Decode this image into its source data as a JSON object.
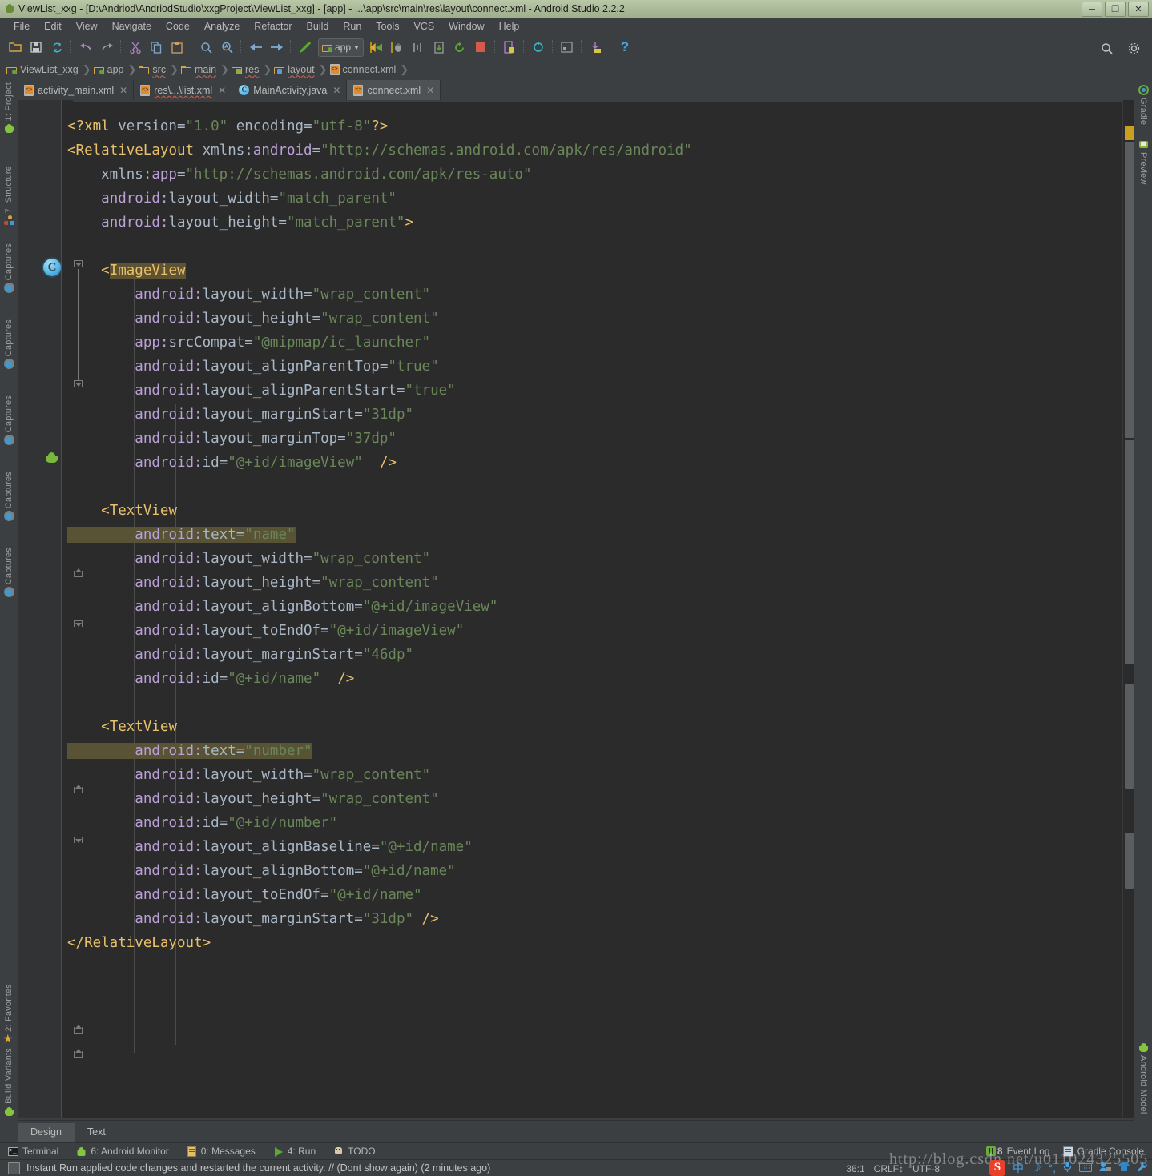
{
  "window": {
    "title": "ViewList_xxg - [D:\\Andriod\\AndriodStudio\\xxgProject\\ViewList_xxg] - [app] - ...\\app\\src\\main\\res\\layout\\connect.xml - Android Studio 2.2.2",
    "minimize": "─",
    "maximize": "❐",
    "close": "✕"
  },
  "menubar": [
    {
      "label": "File"
    },
    {
      "label": "Edit"
    },
    {
      "label": "View"
    },
    {
      "label": "Navigate"
    },
    {
      "label": "Code"
    },
    {
      "label": "Analyze"
    },
    {
      "label": "Refactor"
    },
    {
      "label": "Build"
    },
    {
      "label": "Run"
    },
    {
      "label": "Tools"
    },
    {
      "label": "VCS"
    },
    {
      "label": "Window"
    },
    {
      "label": "Help"
    }
  ],
  "toolbar": {
    "run_config": "app",
    "run_config_arrow": "▼",
    "icons": [
      "open-project-icon",
      "save-all-icon",
      "sync-icon",
      "undo-icon",
      "redo-icon",
      "cut-icon",
      "copy-icon",
      "paste-icon",
      "find-icon",
      "replace-icon",
      "back-icon",
      "forward-icon",
      "build-icon"
    ],
    "right_icons": [
      "search-everywhere-icon",
      "help-icon"
    ],
    "help_glyph": "?",
    "search_glyph": "⌕"
  },
  "breadcrumb": [
    {
      "label": "ViewList_xxg",
      "icon": "module-folder-icon"
    },
    {
      "label": "app",
      "icon": "module-folder-icon"
    },
    {
      "label": "src",
      "icon": "folder-icon"
    },
    {
      "label": "main",
      "icon": "folder-icon"
    },
    {
      "label": "res",
      "icon": "res-folder-icon"
    },
    {
      "label": "layout",
      "icon": "layout-folder-icon"
    },
    {
      "label": "connect.xml",
      "icon": "xml-file-icon"
    }
  ],
  "breadcrumb_separator": "❯",
  "editor_tabs": [
    {
      "label": "activity_main.xml",
      "icon": "xml-file-icon",
      "active": false,
      "squiggly": false
    },
    {
      "label": "res\\...\\list.xml",
      "icon": "xml-file-icon",
      "active": false,
      "squiggly": true
    },
    {
      "label": "MainActivity.java",
      "icon": "java-class-icon",
      "active": false,
      "squiggly": false
    },
    {
      "label": "connect.xml",
      "icon": "xml-file-icon",
      "active": true,
      "squiggly": false
    }
  ],
  "tab_close_glyph": "✕",
  "left_tool_strip": [
    {
      "label": "1: Project",
      "icon": "android-icon"
    },
    {
      "label": "7: Structure",
      "icon": "structure-icon"
    },
    {
      "label": "Captures",
      "icon": "captures-icon"
    },
    {
      "label": "Captures",
      "icon": "captures-icon"
    },
    {
      "label": "Captures",
      "icon": "captures-icon"
    },
    {
      "label": "Captures",
      "icon": "captures-icon"
    },
    {
      "label": "Captures",
      "icon": "captures-icon"
    },
    {
      "label": "2: Favorites",
      "icon": "star-icon"
    },
    {
      "label": "Build Variants",
      "icon": "android-icon"
    }
  ],
  "right_tool_strip": [
    {
      "label": "Gradle",
      "icon": "gradle-icon"
    },
    {
      "label": "Preview",
      "icon": "preview-icon"
    },
    {
      "label": "Android Model",
      "icon": "android-icon"
    }
  ],
  "code": {
    "language": "xml",
    "lines": [
      [
        {
          "t": "<?xml ",
          "c": "tag"
        },
        {
          "t": "version=",
          "c": "plain"
        },
        {
          "t": "\"1.0\"",
          "c": "val"
        },
        {
          "t": " encoding=",
          "c": "plain"
        },
        {
          "t": "\"utf-8\"",
          "c": "val"
        },
        {
          "t": "?>",
          "c": "tag"
        }
      ],
      [
        {
          "t": "<",
          "c": "brack"
        },
        {
          "t": "RelativeLayout",
          "c": "tag"
        },
        {
          "t": " xmlns:",
          "c": "plain"
        },
        {
          "t": "android",
          "c": "attr"
        },
        {
          "t": "=",
          "c": "plain"
        },
        {
          "t": "\"http://schemas.android.com/apk/res/android\"",
          "c": "val"
        }
      ],
      [
        {
          "t": "    xmlns:",
          "c": "plain"
        },
        {
          "t": "app",
          "c": "attr"
        },
        {
          "t": "=",
          "c": "plain"
        },
        {
          "t": "\"http://schemas.android.com/apk/res-auto\"",
          "c": "val"
        }
      ],
      [
        {
          "t": "    ",
          "c": "plain"
        },
        {
          "t": "android:",
          "c": "attr"
        },
        {
          "t": "layout_width",
          "c": "plain"
        },
        {
          "t": "=",
          "c": "plain"
        },
        {
          "t": "\"match_parent\"",
          "c": "val"
        }
      ],
      [
        {
          "t": "    ",
          "c": "plain"
        },
        {
          "t": "android:",
          "c": "attr"
        },
        {
          "t": "layout_height",
          "c": "plain"
        },
        {
          "t": "=",
          "c": "plain"
        },
        {
          "t": "\"match_parent\"",
          "c": "val"
        },
        {
          "t": ">",
          "c": "brack"
        }
      ],
      [],
      [
        {
          "t": "    ",
          "c": "plain"
        },
        {
          "t": "<",
          "c": "brack"
        },
        {
          "t": "ImageView",
          "c": "tag",
          "hl": "tag"
        }
      ],
      [
        {
          "t": "        ",
          "c": "plain"
        },
        {
          "t": "android:",
          "c": "attr"
        },
        {
          "t": "layout_width",
          "c": "plain"
        },
        {
          "t": "=",
          "c": "plain"
        },
        {
          "t": "\"wrap_content\"",
          "c": "val"
        }
      ],
      [
        {
          "t": "        ",
          "c": "plain"
        },
        {
          "t": "android:",
          "c": "attr"
        },
        {
          "t": "layout_height",
          "c": "plain"
        },
        {
          "t": "=",
          "c": "plain"
        },
        {
          "t": "\"wrap_content\"",
          "c": "val"
        }
      ],
      [
        {
          "t": "        ",
          "c": "plain"
        },
        {
          "t": "app:",
          "c": "attr"
        },
        {
          "t": "srcCompat",
          "c": "plain"
        },
        {
          "t": "=",
          "c": "plain"
        },
        {
          "t": "\"@mipmap/ic_launcher\"",
          "c": "val"
        }
      ],
      [
        {
          "t": "        ",
          "c": "plain"
        },
        {
          "t": "android:",
          "c": "attr"
        },
        {
          "t": "layout_alignParentTop",
          "c": "plain"
        },
        {
          "t": "=",
          "c": "plain"
        },
        {
          "t": "\"true\"",
          "c": "val"
        }
      ],
      [
        {
          "t": "        ",
          "c": "plain"
        },
        {
          "t": "android:",
          "c": "attr"
        },
        {
          "t": "layout_alignParentStart",
          "c": "plain"
        },
        {
          "t": "=",
          "c": "plain"
        },
        {
          "t": "\"true\"",
          "c": "val"
        }
      ],
      [
        {
          "t": "        ",
          "c": "plain"
        },
        {
          "t": "android:",
          "c": "attr"
        },
        {
          "t": "layout_marginStart",
          "c": "plain"
        },
        {
          "t": "=",
          "c": "plain"
        },
        {
          "t": "\"31dp\"",
          "c": "val"
        }
      ],
      [
        {
          "t": "        ",
          "c": "plain"
        },
        {
          "t": "android:",
          "c": "attr"
        },
        {
          "t": "layout_marginTop",
          "c": "plain"
        },
        {
          "t": "=",
          "c": "plain"
        },
        {
          "t": "\"37dp\"",
          "c": "val"
        }
      ],
      [
        {
          "t": "        ",
          "c": "plain"
        },
        {
          "t": "android:",
          "c": "attr"
        },
        {
          "t": "id",
          "c": "plain"
        },
        {
          "t": "=",
          "c": "plain"
        },
        {
          "t": "\"@+id/imageView\"",
          "c": "val"
        },
        {
          "t": "  ",
          "c": "plain"
        },
        {
          "t": "/>",
          "c": "brack"
        }
      ],
      [],
      [
        {
          "t": "    ",
          "c": "plain"
        },
        {
          "t": "<",
          "c": "brack"
        },
        {
          "t": "TextView",
          "c": "tag"
        }
      ],
      [
        {
          "t": "        ",
          "c": "plain",
          "hl": "line"
        },
        {
          "t": "android:",
          "c": "attr",
          "hl": "line"
        },
        {
          "t": "text",
          "c": "plain",
          "hl": "line"
        },
        {
          "t": "=",
          "c": "plain",
          "hl": "line"
        },
        {
          "t": "\"name\"",
          "c": "val",
          "hl": "line"
        }
      ],
      [
        {
          "t": "        ",
          "c": "plain"
        },
        {
          "t": "android:",
          "c": "attr"
        },
        {
          "t": "layout_width",
          "c": "plain"
        },
        {
          "t": "=",
          "c": "plain"
        },
        {
          "t": "\"wrap_content\"",
          "c": "val"
        }
      ],
      [
        {
          "t": "        ",
          "c": "plain"
        },
        {
          "t": "android:",
          "c": "attr"
        },
        {
          "t": "layout_height",
          "c": "plain"
        },
        {
          "t": "=",
          "c": "plain"
        },
        {
          "t": "\"wrap_content\"",
          "c": "val"
        }
      ],
      [
        {
          "t": "        ",
          "c": "plain"
        },
        {
          "t": "android:",
          "c": "attr"
        },
        {
          "t": "layout_alignBottom",
          "c": "plain"
        },
        {
          "t": "=",
          "c": "plain"
        },
        {
          "t": "\"@+id/imageView\"",
          "c": "val"
        }
      ],
      [
        {
          "t": "        ",
          "c": "plain"
        },
        {
          "t": "android:",
          "c": "attr"
        },
        {
          "t": "layout_toEndOf",
          "c": "plain"
        },
        {
          "t": "=",
          "c": "plain"
        },
        {
          "t": "\"@+id/imageView\"",
          "c": "val"
        }
      ],
      [
        {
          "t": "        ",
          "c": "plain"
        },
        {
          "t": "android:",
          "c": "attr"
        },
        {
          "t": "layout_marginStart",
          "c": "plain"
        },
        {
          "t": "=",
          "c": "plain"
        },
        {
          "t": "\"46dp\"",
          "c": "val"
        }
      ],
      [
        {
          "t": "        ",
          "c": "plain"
        },
        {
          "t": "android:",
          "c": "attr"
        },
        {
          "t": "id",
          "c": "plain"
        },
        {
          "t": "=",
          "c": "plain"
        },
        {
          "t": "\"@+id/name\"",
          "c": "val"
        },
        {
          "t": "  ",
          "c": "plain"
        },
        {
          "t": "/>",
          "c": "brack"
        }
      ],
      [],
      [
        {
          "t": "    ",
          "c": "plain"
        },
        {
          "t": "<",
          "c": "brack"
        },
        {
          "t": "TextView",
          "c": "tag"
        }
      ],
      [
        {
          "t": "        ",
          "c": "plain",
          "hl": "line"
        },
        {
          "t": "android:",
          "c": "attr",
          "hl": "line"
        },
        {
          "t": "text",
          "c": "plain",
          "hl": "line"
        },
        {
          "t": "=",
          "c": "plain",
          "hl": "line"
        },
        {
          "t": "\"number\"",
          "c": "val",
          "hl": "line"
        }
      ],
      [
        {
          "t": "        ",
          "c": "plain"
        },
        {
          "t": "android:",
          "c": "attr"
        },
        {
          "t": "layout_width",
          "c": "plain"
        },
        {
          "t": "=",
          "c": "plain"
        },
        {
          "t": "\"wrap_content\"",
          "c": "val"
        }
      ],
      [
        {
          "t": "        ",
          "c": "plain"
        },
        {
          "t": "android:",
          "c": "attr"
        },
        {
          "t": "layout_height",
          "c": "plain"
        },
        {
          "t": "=",
          "c": "plain"
        },
        {
          "t": "\"wrap_content\"",
          "c": "val"
        }
      ],
      [
        {
          "t": "        ",
          "c": "plain"
        },
        {
          "t": "android:",
          "c": "attr"
        },
        {
          "t": "id",
          "c": "plain"
        },
        {
          "t": "=",
          "c": "plain"
        },
        {
          "t": "\"@+id/number\"",
          "c": "val"
        }
      ],
      [
        {
          "t": "        ",
          "c": "plain"
        },
        {
          "t": "android:",
          "c": "attr"
        },
        {
          "t": "layout_alignBaseline",
          "c": "plain"
        },
        {
          "t": "=",
          "c": "plain"
        },
        {
          "t": "\"@+id/name\"",
          "c": "val"
        }
      ],
      [
        {
          "t": "        ",
          "c": "plain"
        },
        {
          "t": "android:",
          "c": "attr"
        },
        {
          "t": "layout_alignBottom",
          "c": "plain"
        },
        {
          "t": "=",
          "c": "plain"
        },
        {
          "t": "\"@+id/name\"",
          "c": "val"
        }
      ],
      [
        {
          "t": "        ",
          "c": "plain"
        },
        {
          "t": "android:",
          "c": "attr"
        },
        {
          "t": "layout_toEndOf",
          "c": "plain"
        },
        {
          "t": "=",
          "c": "plain"
        },
        {
          "t": "\"@+id/name\"",
          "c": "val"
        }
      ],
      [
        {
          "t": "        ",
          "c": "plain"
        },
        {
          "t": "android:",
          "c": "attr"
        },
        {
          "t": "layout_marginStart",
          "c": "plain"
        },
        {
          "t": "=",
          "c": "plain"
        },
        {
          "t": "\"31dp\"",
          "c": "val"
        },
        {
          "t": " ",
          "c": "plain"
        },
        {
          "t": "/>",
          "c": "brack"
        }
      ],
      [
        {
          "t": "</",
          "c": "brack"
        },
        {
          "t": "RelativeLayout",
          "c": "tag"
        },
        {
          "t": ">",
          "c": "brack"
        }
      ]
    ]
  },
  "design_text_tabs": [
    {
      "label": "Design",
      "active": true
    },
    {
      "label": "Text",
      "active": false
    }
  ],
  "bottom_tools": [
    {
      "label": "Terminal",
      "icon": "terminal-icon",
      "mnemonic": ""
    },
    {
      "label": "6: Android Monitor",
      "icon": "android-icon",
      "mnemonic": "6"
    },
    {
      "label": "0: Messages",
      "icon": "messages-icon",
      "mnemonic": "0"
    },
    {
      "label": "4: Run",
      "icon": "run-icon",
      "mnemonic": "4"
    },
    {
      "label": "TODO",
      "icon": "todo-icon",
      "mnemonic": ""
    }
  ],
  "bottom_right": [
    {
      "label": "Event Log",
      "icon": "event-log-icon",
      "count": "8"
    },
    {
      "label": "Gradle Console",
      "icon": "gradle-console-icon",
      "count": ""
    }
  ],
  "status": {
    "message": "Instant Run applied code changes and restarted the current activity. // (Dont show again) (2 minutes ago)",
    "caret": "36:1",
    "line_separator": "CRLF↕",
    "encoding": "UTF-8"
  },
  "watermark": "http://blog.csdn.net/u011024325505",
  "ime": {
    "sogou": "S",
    "mode": "中",
    "moon": "☽",
    "punct": "°,",
    "mic": "Ἲ4",
    "keyboard": "⌨",
    "skin": "ὅ5",
    "tools": "ὒ7"
  },
  "colors": {
    "editor_bg": "#2b2b2b",
    "chrome_bg": "#3c3f41",
    "tag": "#e8bf6a",
    "attr": "#b9a0d6",
    "value": "#6a8759",
    "plain": "#a9b7c6",
    "highlight": "#585334",
    "titlebar": "#aebd9c"
  }
}
